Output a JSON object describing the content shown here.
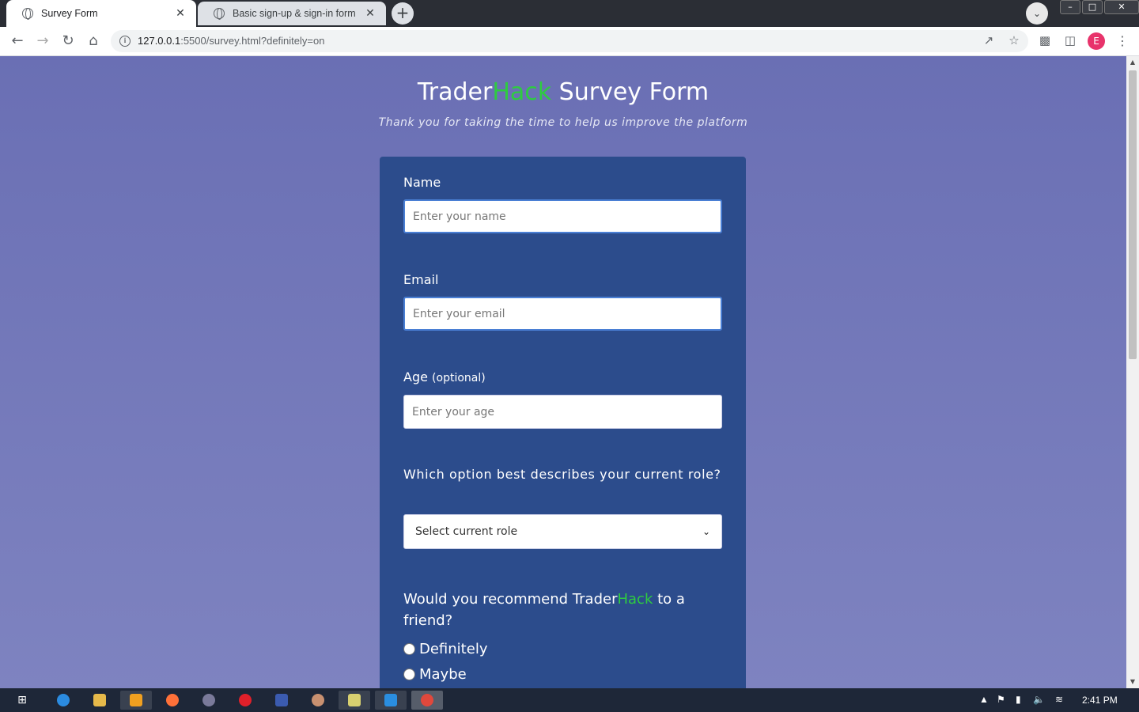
{
  "browser": {
    "tabs": [
      {
        "title": "Survey Form",
        "active": true
      },
      {
        "title": "Basic sign-up & sign-in form",
        "active": false
      }
    ],
    "new_tab_symbol": "+",
    "close_symbol": "✕",
    "url": {
      "host": "127.0.0.1",
      "rest": ":5500/survey.html?definitely=on"
    },
    "profile_initial": "E",
    "accent_color": "#e8336b"
  },
  "page": {
    "title_part1": "Trader",
    "title_part2": "Hack",
    "title_part3": " Survey Form",
    "description": "Thank you for taking the time to help us improve the platform",
    "brand_color": "#2ecc40",
    "background_color": "#6a72b8",
    "card_color": "#2c4c8c"
  },
  "form": {
    "name": {
      "label": "Name",
      "placeholder": "Enter your name"
    },
    "email": {
      "label": "Email",
      "placeholder": "Enter your email"
    },
    "age": {
      "label": "Age",
      "label_suffix": "(optional)",
      "placeholder": "Enter your age"
    },
    "role": {
      "question": "Which option best describes your current role?",
      "selected": "Select current role"
    },
    "recommend": {
      "question_part1": "Would you recommend Trader",
      "question_part2": "Hack",
      "question_part3": " to a friend?",
      "options": [
        {
          "label": "Definitely"
        },
        {
          "label": "Maybe"
        }
      ]
    }
  },
  "taskbar": {
    "clock": "2:41 PM"
  }
}
